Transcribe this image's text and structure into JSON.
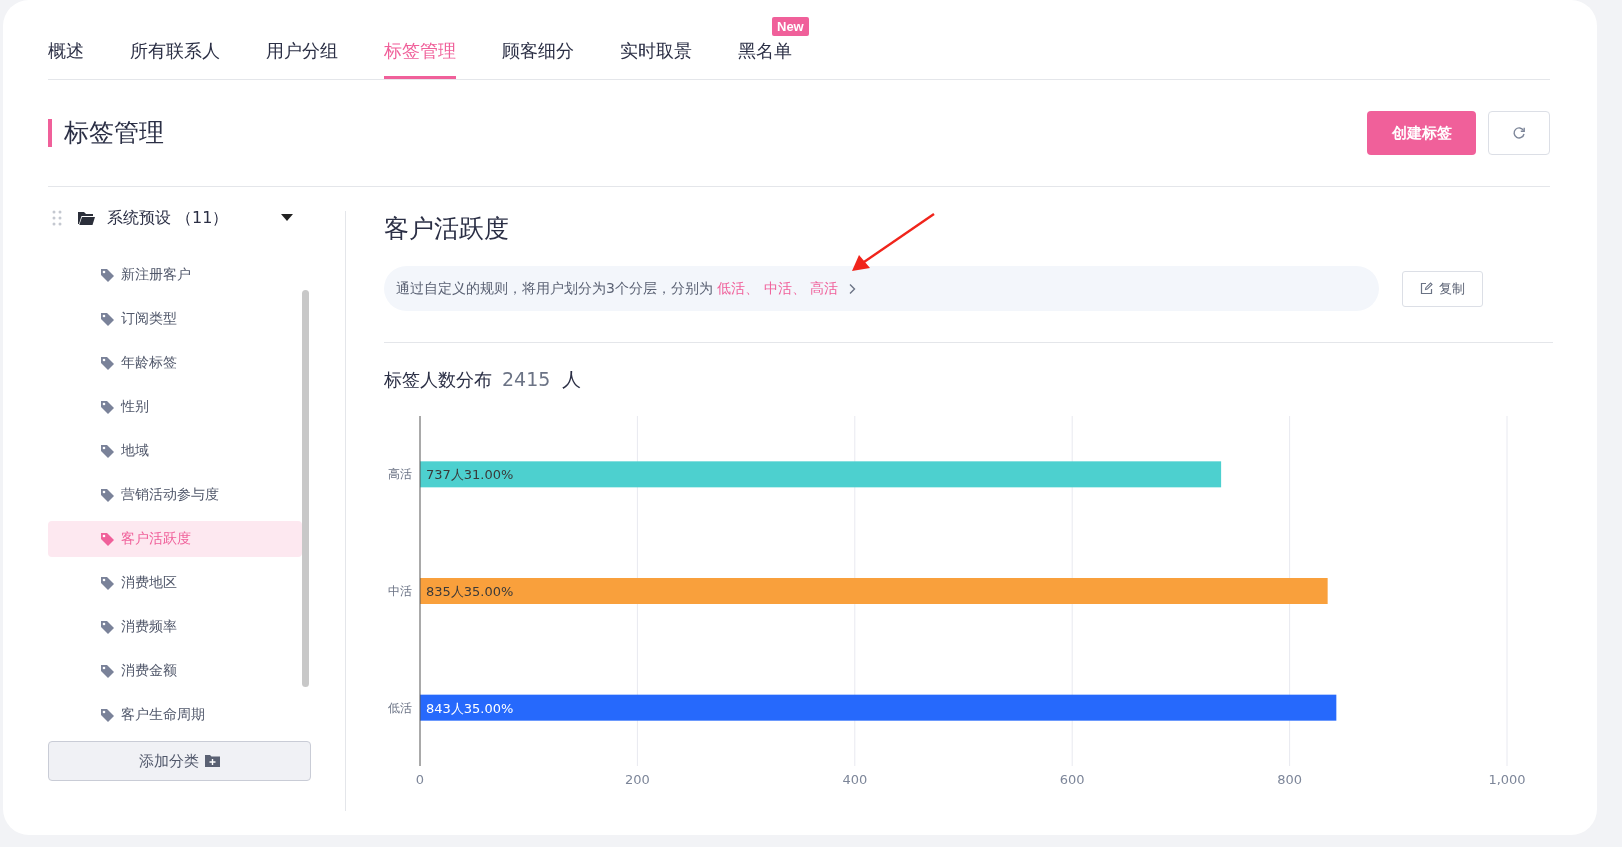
{
  "tabs": [
    {
      "label": "概述",
      "selected": false
    },
    {
      "label": "所有联系人",
      "selected": false
    },
    {
      "label": "用户分组",
      "selected": false
    },
    {
      "label": "标签管理",
      "selected": true
    },
    {
      "label": "顾客细分",
      "selected": false
    },
    {
      "label": "实时取景",
      "selected": false
    },
    {
      "label": "黑名单",
      "selected": false,
      "badge": "New"
    }
  ],
  "page_title": "标签管理",
  "header_buttons": {
    "create": "创建标签"
  },
  "sidebar": {
    "group": {
      "label": "系统预设 （11）",
      "expanded": true
    },
    "items": [
      {
        "label": "新注册客户",
        "selected": false
      },
      {
        "label": "订阅类型",
        "selected": false
      },
      {
        "label": "年龄标签",
        "selected": false
      },
      {
        "label": "性别",
        "selected": false
      },
      {
        "label": "地域",
        "selected": false
      },
      {
        "label": "营销活动参与度",
        "selected": false
      },
      {
        "label": "客户活跃度",
        "selected": true
      },
      {
        "label": "消费地区",
        "selected": false
      },
      {
        "label": "消费频率",
        "selected": false
      },
      {
        "label": "消费金额",
        "selected": false
      },
      {
        "label": "客户生命周期",
        "selected": false
      }
    ],
    "add_button": "添加分类"
  },
  "detail": {
    "title": "客户活跃度",
    "description": {
      "text": "通过自定义的规则，将用户划分为3个分层，分别为",
      "links": [
        "低活、",
        "中活、",
        "高活"
      ]
    },
    "copy_button": "复制",
    "distribution": {
      "title": "标签人数分布",
      "count": "2415",
      "unit": "人",
      "chart_data": {
        "type": "bar",
        "orientation": "horizontal",
        "stacked": true,
        "categories": [
          "高活",
          "中活",
          "低活"
        ],
        "grid": true,
        "series": [
          {
            "color": "#4dd0cf",
            "values": [
              737,
              null,
              null
            ]
          },
          {
            "color": "#f9a03c",
            "values": [
              null,
              835,
              null
            ]
          },
          {
            "color": "#2669fc",
            "values": [
              null,
              null,
              843
            ]
          }
        ],
        "value_labels": [
          "737人31.00%",
          "835人35.00%",
          "843人35.00%"
        ],
        "xlim": [
          0,
          1000
        ],
        "xticks": [
          0,
          200,
          400,
          600,
          800,
          {
            "value": 1000,
            "label": "1,000"
          }
        ]
      }
    }
  }
}
